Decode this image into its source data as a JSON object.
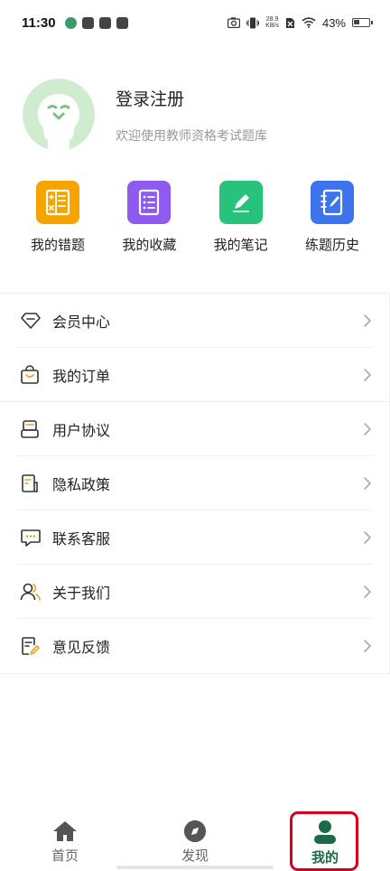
{
  "statusbar": {
    "time": "11:30",
    "speed_top": "28.9",
    "speed_bottom": "KB/s",
    "battery_text": "43%",
    "battery_level": 0.43
  },
  "profile": {
    "title": "登录注册",
    "subtitle": "欢迎使用教师资格考试题库"
  },
  "quick_entries": [
    {
      "label": "我的错题",
      "icon": "wrong-questions-icon",
      "color": "#f5a400"
    },
    {
      "label": "我的收藏",
      "icon": "favorites-list-icon",
      "color": "#8e5af0"
    },
    {
      "label": "我的笔记",
      "icon": "notes-pen-icon",
      "color": "#27c27b"
    },
    {
      "label": "练题历史",
      "icon": "history-notebook-icon",
      "color": "#3d74ec"
    }
  ],
  "menu_group_1": [
    {
      "label": "会员中心",
      "icon": "diamond-icon"
    },
    {
      "label": "我的订单",
      "icon": "shopping-bag-icon"
    }
  ],
  "menu_group_2": [
    {
      "label": "用户协议",
      "icon": "agreement-icon"
    },
    {
      "label": "隐私政策",
      "icon": "privacy-document-icon"
    },
    {
      "label": "联系客服",
      "icon": "chat-icon"
    },
    {
      "label": "关于我们",
      "icon": "users-icon"
    },
    {
      "label": "意见反馈",
      "icon": "feedback-icon"
    }
  ],
  "tabbar": {
    "home": "首页",
    "discover": "发现",
    "mine": "我的"
  },
  "colors": {
    "accent_green": "#1e6a48",
    "avatar_green": "#cfeccf",
    "highlight_red": "#d4001c"
  }
}
